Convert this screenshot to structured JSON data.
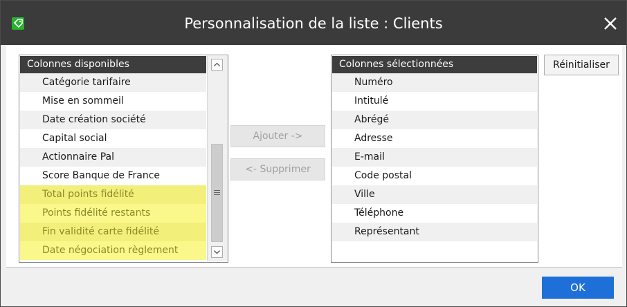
{
  "window": {
    "title": "Personnalisation de la liste : Clients",
    "app_icon": "green-tag-icon",
    "close_icon": "close-icon"
  },
  "available": {
    "header": "Colonnes disponibles",
    "items": [
      {
        "label": "Catégorie tarifaire",
        "highlighted": false
      },
      {
        "label": "Mise en sommeil",
        "highlighted": false
      },
      {
        "label": "Date création société",
        "highlighted": false
      },
      {
        "label": "Capital social",
        "highlighted": false
      },
      {
        "label": "Actionnaire Pal",
        "highlighted": false
      },
      {
        "label": "Score Banque de France",
        "highlighted": false
      },
      {
        "label": "Total points fidélité",
        "highlighted": true
      },
      {
        "label": "Points fidélité restants",
        "highlighted": true
      },
      {
        "label": "Fin validité carte fidélité",
        "highlighted": true
      },
      {
        "label": "Date négociation règlement",
        "highlighted": true
      }
    ]
  },
  "selected": {
    "header": "Colonnes sélectionnées",
    "items": [
      "Numéro",
      "Intitulé",
      "Abrégé",
      "Adresse",
      "E-mail",
      "Code postal",
      "Ville",
      "Téléphone",
      "Représentant"
    ]
  },
  "buttons": {
    "add": "Ajouter ->",
    "remove": "<- Supprimer",
    "reset": "Réinitialiser",
    "ok": "OK"
  },
  "colors": {
    "titlebar": "#3b3b3b",
    "highlight": "#faf88a",
    "ok_button": "#1e70d8"
  }
}
